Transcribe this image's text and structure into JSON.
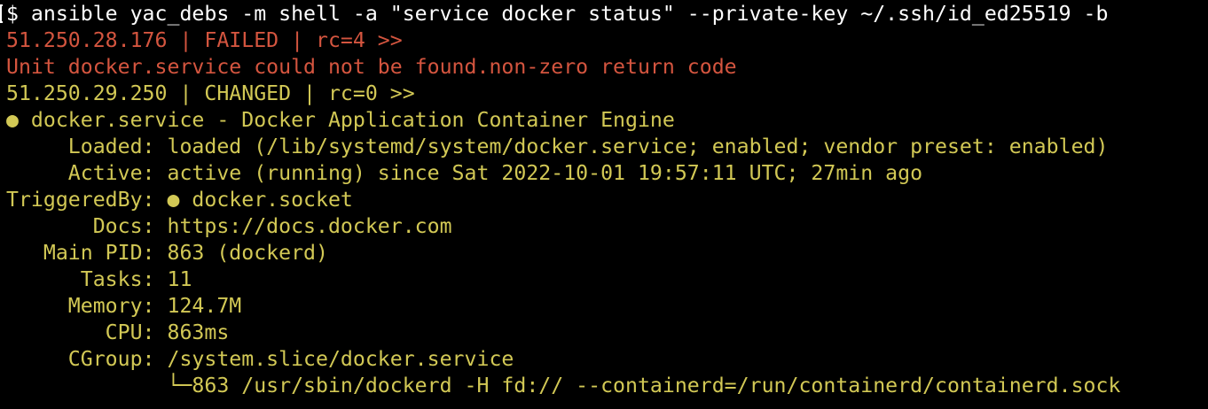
{
  "colors": {
    "background": "#000000",
    "command": "#ffffff",
    "failed": "#d4553f",
    "changed": "#d2c855"
  },
  "terminal": {
    "command": "$ ansible yac_debs -m shell -a \"service docker status\" --private-key ~/.ssh/id_ed25519 -b",
    "lines": [
      {
        "text": "51.250.28.176 | FAILED | rc=4 >>",
        "style": "failed"
      },
      {
        "text": "Unit docker.service could not be found.non-zero return code",
        "style": "failed"
      },
      {
        "text": "51.250.29.250 | CHANGED | rc=0 >>",
        "style": "changed"
      },
      {
        "text": "● docker.service - Docker Application Container Engine",
        "style": "changed"
      },
      {
        "text": "     Loaded: loaded (/lib/systemd/system/docker.service; enabled; vendor preset: enabled)",
        "style": "changed"
      },
      {
        "text": "     Active: active (running) since Sat 2022-10-01 19:57:11 UTC; 27min ago",
        "style": "changed"
      },
      {
        "text": "TriggeredBy: ● docker.socket",
        "style": "changed"
      },
      {
        "text": "       Docs: https://docs.docker.com",
        "style": "changed"
      },
      {
        "text": "   Main PID: 863 (dockerd)",
        "style": "changed"
      },
      {
        "text": "      Tasks: 11",
        "style": "changed"
      },
      {
        "text": "     Memory: 124.7M",
        "style": "changed"
      },
      {
        "text": "        CPU: 863ms",
        "style": "changed"
      },
      {
        "text": "     CGroup: /system.slice/docker.service",
        "style": "changed"
      },
      {
        "text": "             └─863 /usr/sbin/dockerd -H fd:// --containerd=/run/containerd/containerd.sock",
        "style": "changed"
      }
    ]
  }
}
